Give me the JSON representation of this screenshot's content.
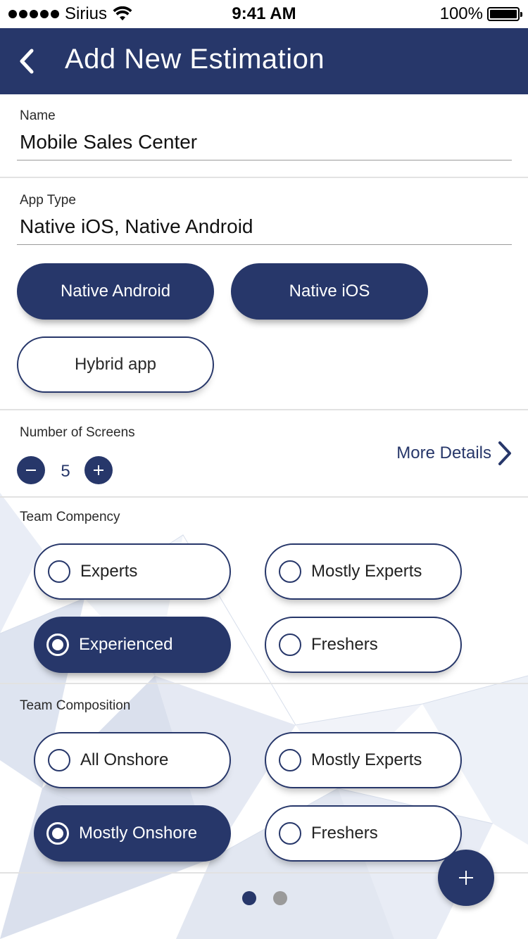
{
  "status_bar": {
    "carrier": "Sirius",
    "time": "9:41 AM",
    "battery": "100%"
  },
  "header": {
    "title": "Add New Estimation"
  },
  "name_field": {
    "label": "Name",
    "value": "Mobile Sales Center"
  },
  "app_type": {
    "label": "App Type",
    "value": "Native iOS, Native Android",
    "options": [
      {
        "label": "Native Android",
        "selected": true
      },
      {
        "label": "Native iOS",
        "selected": true
      },
      {
        "label": "Hybrid app",
        "selected": false
      }
    ]
  },
  "screens": {
    "label": "Number of Screens",
    "value": "5",
    "more_details": "More Details"
  },
  "team_competency": {
    "label": "Team Compency",
    "options": [
      {
        "label": "Experts",
        "selected": false
      },
      {
        "label": "Mostly Experts",
        "selected": false
      },
      {
        "label": "Experienced",
        "selected": true
      },
      {
        "label": "Freshers",
        "selected": false
      }
    ]
  },
  "team_composition": {
    "label": "Team Composition",
    "options": [
      {
        "label": "All Onshore",
        "selected": false
      },
      {
        "label": "Mostly Experts",
        "selected": false
      },
      {
        "label": "Mostly Onshore",
        "selected": true
      },
      {
        "label": "Freshers",
        "selected": false
      }
    ]
  },
  "pagination": {
    "current": 1,
    "total": 2
  },
  "colors": {
    "primary": "#27376a",
    "inactive_dot": "#9a9a9a"
  }
}
